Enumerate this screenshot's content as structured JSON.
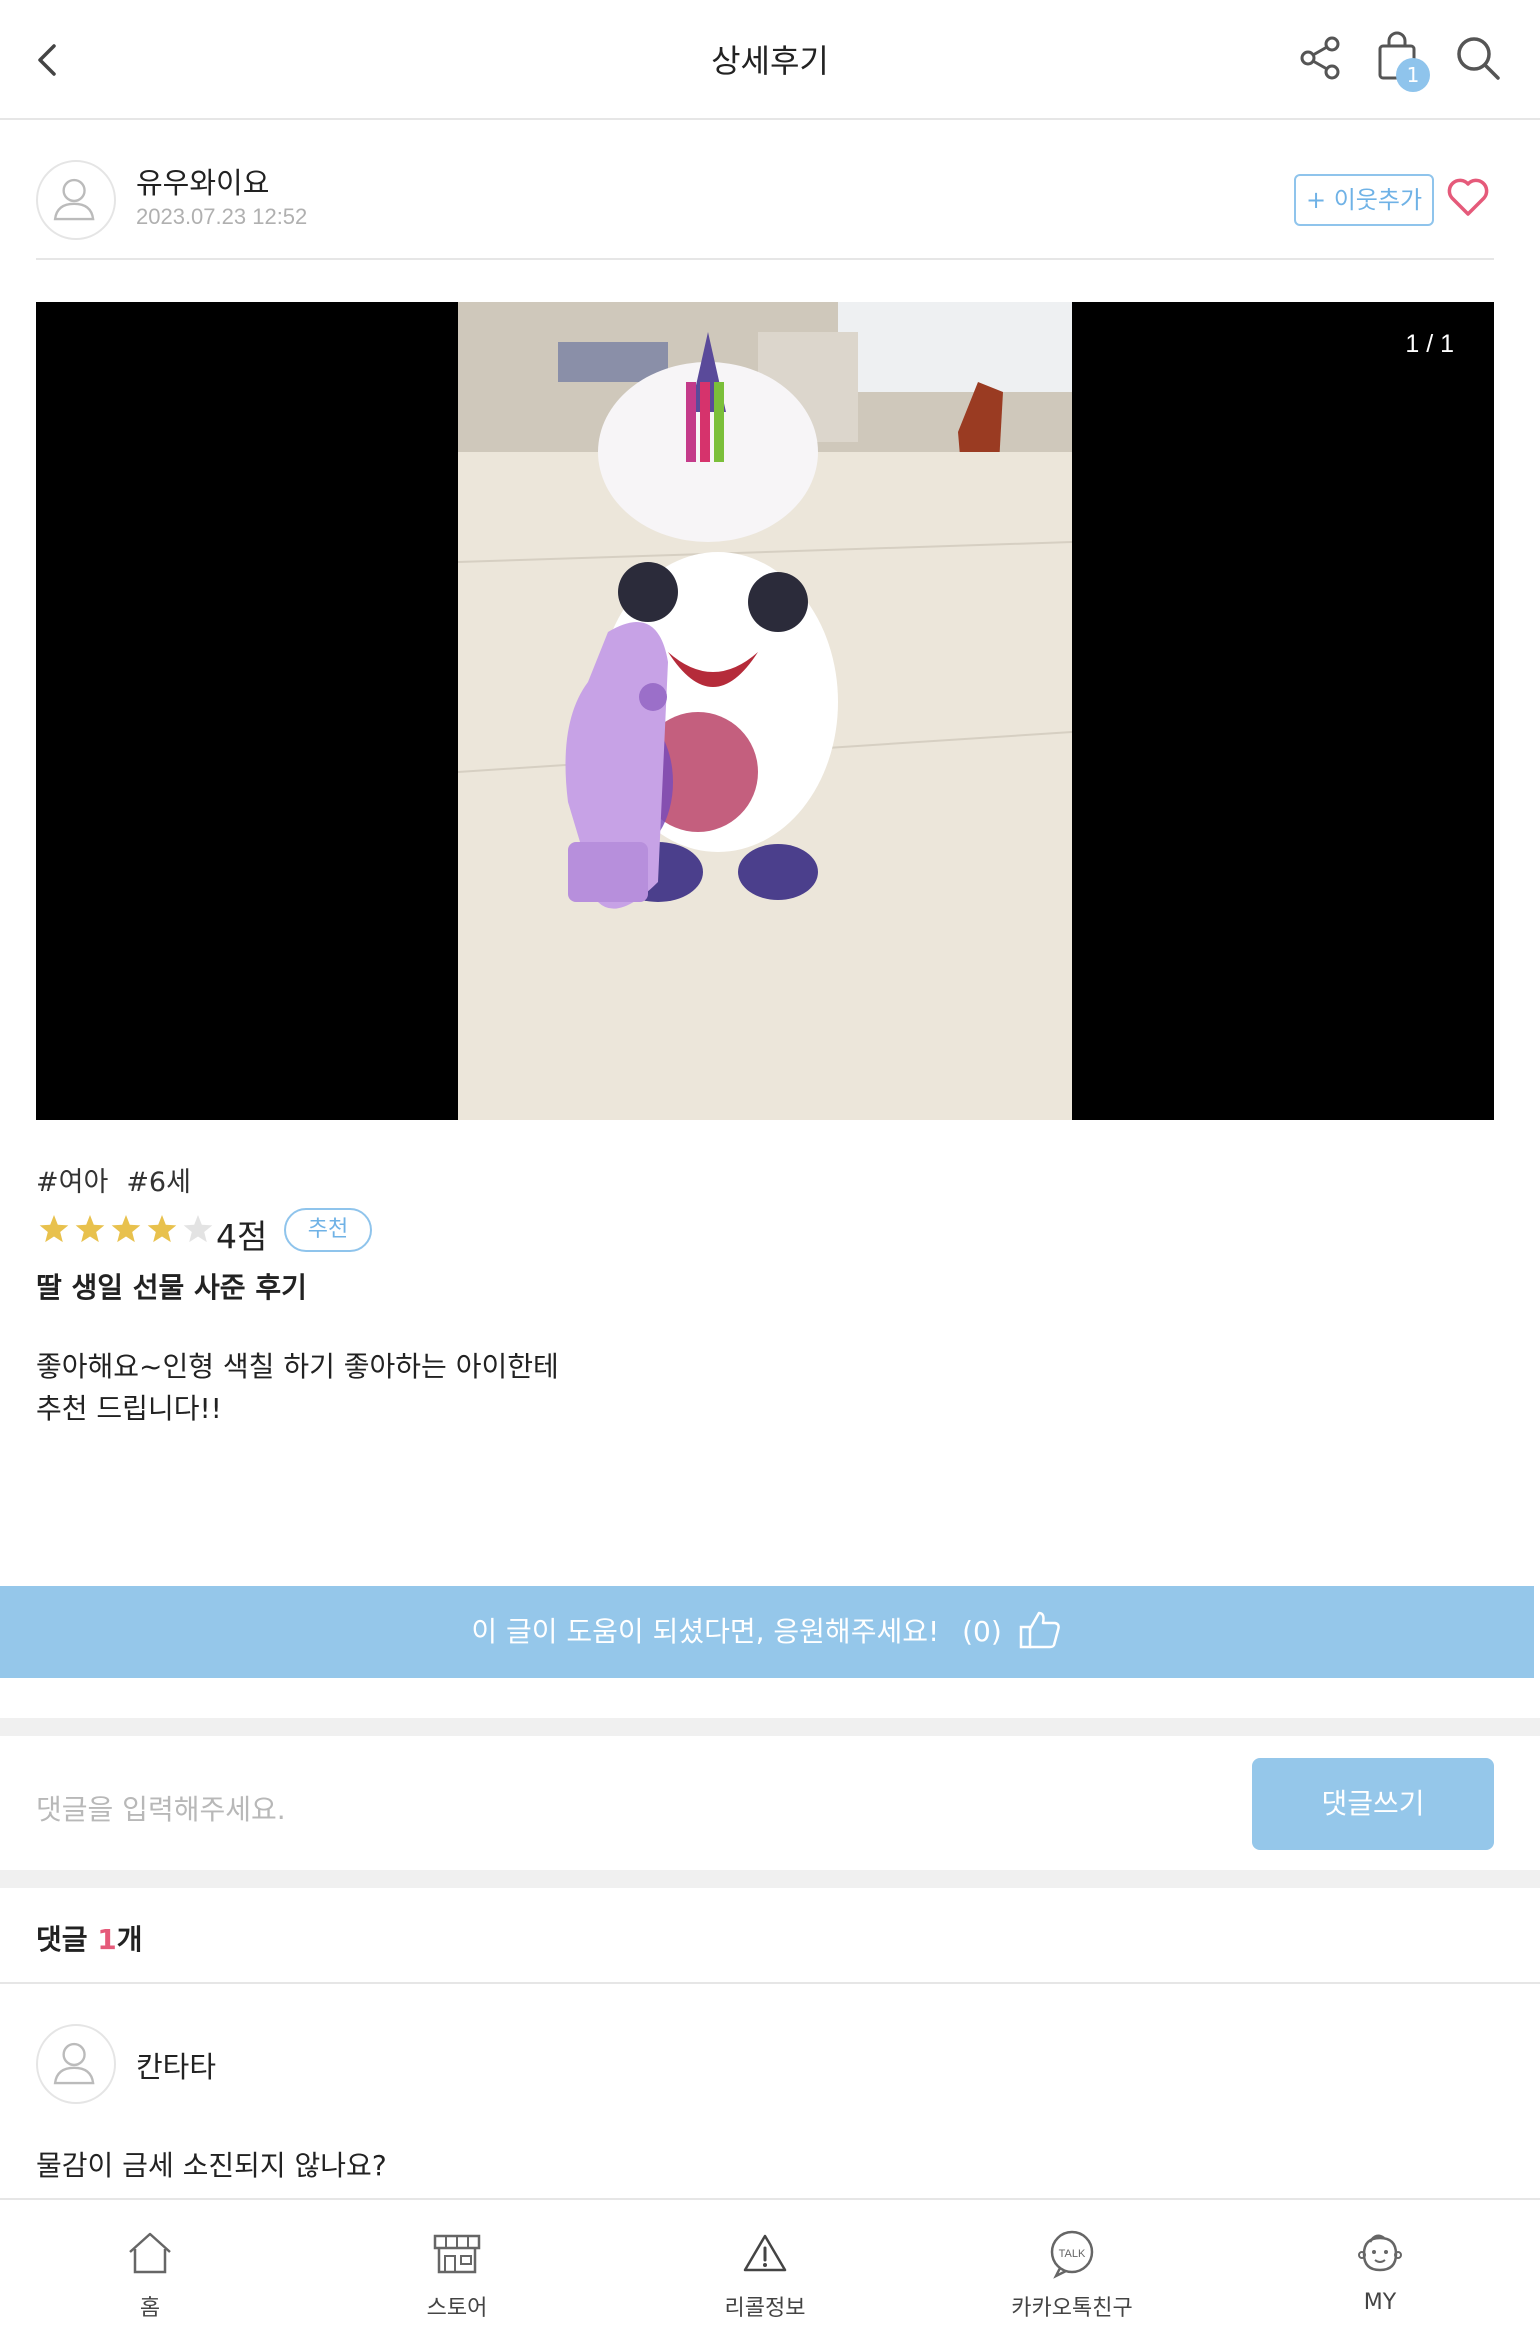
{
  "header": {
    "title": "상세후기",
    "cart_count": "1"
  },
  "author": {
    "name": "유우와이요",
    "date": "2023.07.23 12:52",
    "follow_label": "+ 이웃추가"
  },
  "photo": {
    "counter": "1 / 1"
  },
  "review": {
    "tags": [
      "#여아",
      "#6세"
    ],
    "rating_stars": 4,
    "rating_max": 5,
    "score_label": "4점",
    "badge": "추천",
    "title": "딸 생일 선물 사준 후기",
    "body_lines": [
      "좋아해요~인형 색칠 하기 좋아하는 아이한테",
      "추천 드립니다!!"
    ]
  },
  "cheer": {
    "text": "이 글이 도움이 되셨다면, 응원해주세요!",
    "count": "(0)"
  },
  "comment_box": {
    "placeholder": "댓글을 입력해주세요.",
    "submit_label": "댓글쓰기"
  },
  "comments": {
    "heading_prefix": "댓글 ",
    "count": "1",
    "heading_suffix": "개",
    "items": [
      {
        "author": "칸타타",
        "text": "물감이 금세 소진되지 않나요?"
      }
    ]
  },
  "tabbar": {
    "items": [
      {
        "label": "홈",
        "icon": "home-icon"
      },
      {
        "label": "스토어",
        "icon": "store-icon"
      },
      {
        "label": "리콜정보",
        "icon": "warning-icon"
      },
      {
        "label": "카카오톡친구",
        "icon": "talk-icon"
      },
      {
        "label": "MY",
        "icon": "baby-icon"
      }
    ]
  },
  "colors": {
    "accent": "#95c7ea",
    "accent_text": "#6fb2e6",
    "heart": "#e55a7a",
    "star": "#e8c14d"
  }
}
